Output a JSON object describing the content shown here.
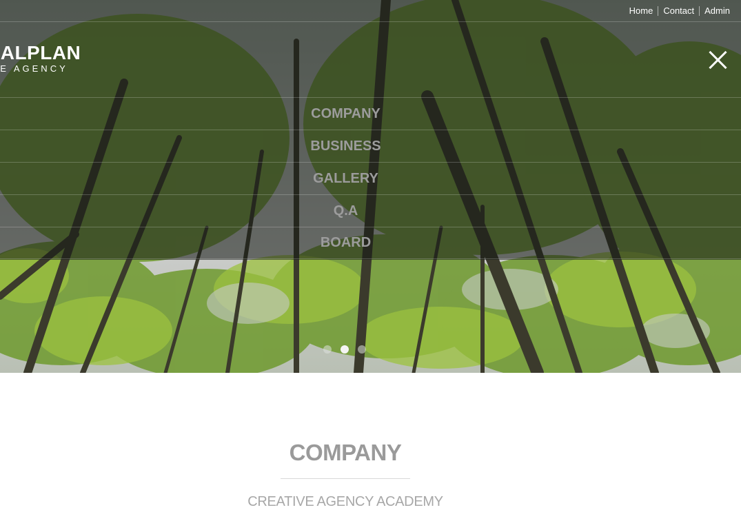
{
  "util_links": [
    "Home",
    "Contact",
    "Admin"
  ],
  "logo": {
    "line1": "UALPLAN",
    "line2": "IVE AGENCY"
  },
  "menu": [
    "COMPANY",
    "BUSINESS",
    "GALLERY",
    "Q.A",
    "BOARD"
  ],
  "slider": {
    "total": 3,
    "active": 2
  },
  "section": {
    "title": "COMPANY",
    "subtitle": "CREATIVE AGENCY ACADEMY"
  },
  "icons": {
    "close": "close-icon"
  }
}
